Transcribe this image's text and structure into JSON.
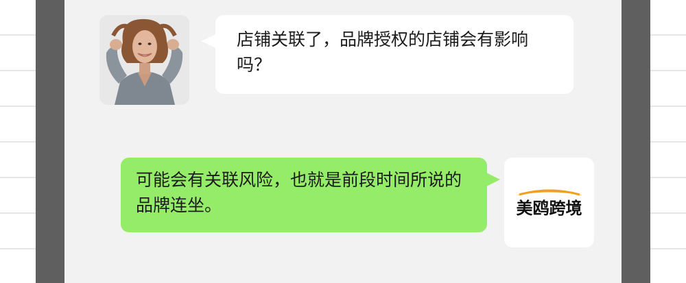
{
  "conversation": {
    "messages": [
      {
        "sender": "customer",
        "text": "店铺关联了，品牌授权的店铺会有影响吗？"
      },
      {
        "sender": "brand",
        "text": "可能会有关联风险，也就是前段时间所说的品牌连坐。"
      }
    ]
  },
  "brand_logo": {
    "text": "美鸥跨境",
    "arc_color": "#f0a020"
  },
  "colors": {
    "outgoing_bubble": "#95ec69",
    "incoming_bubble": "#ffffff",
    "chat_background": "#f2f2f2",
    "frame": "#5f5f5f"
  }
}
